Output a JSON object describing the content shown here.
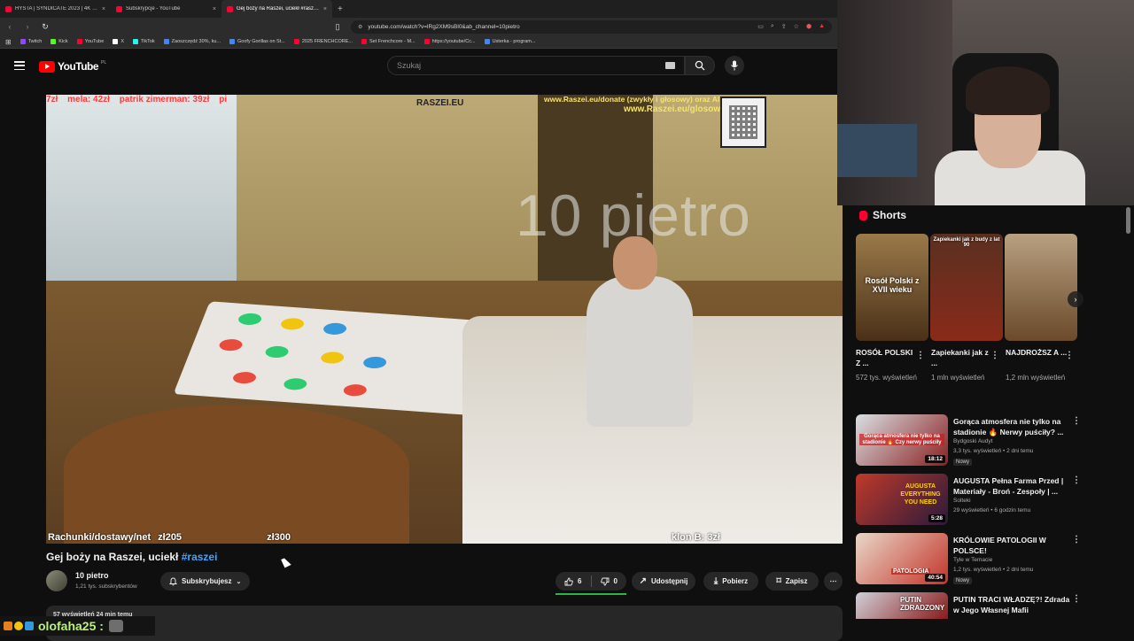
{
  "browser": {
    "tabs": [
      {
        "title": "HYSTA | SYNDICATE 2023 | 4K - YouTube",
        "active": false
      },
      {
        "title": "Subskrypcje - YouTube",
        "active": false
      },
      {
        "title": "Gej boży na Raszei, uciekł #raszei - YouTube",
        "active": true
      }
    ],
    "new_tab": "+",
    "url": "youtube.com/watch?v=lRg2XM9sBl0&ab_channel=10pietro",
    "bookmarks": [
      {
        "label": "Twitch",
        "color": "#9146ff"
      },
      {
        "label": "Kick",
        "color": "#53fc18"
      },
      {
        "label": "YouTube",
        "color": "#ff0033"
      },
      {
        "label": "X",
        "color": "#ffffff"
      },
      {
        "label": "TikTok",
        "color": "#25f4ee"
      },
      {
        "label": "Zaoszczędź 30%, ku...",
        "color": "#4285f4"
      },
      {
        "label": "Goofy Gorillas on St...",
        "color": "#4285f4"
      },
      {
        "label": "2025 FRENCHCORE...",
        "color": "#ff0033"
      },
      {
        "label": "Set Frenchcore - M...",
        "color": "#ff0033"
      },
      {
        "label": "https://youtube/Cc...",
        "color": "#ff0033"
      },
      {
        "label": "Usterka - program...",
        "color": "#4285f4"
      }
    ]
  },
  "yt_header": {
    "logo": "YouTube",
    "country": "PL",
    "search_placeholder": "Szukaj"
  },
  "video_overlay": {
    "top_donations": [
      "7zł",
      "mela: 42zł",
      "patrik zimerman: 39zł",
      "pi"
    ],
    "brand": "RASZEI.EU",
    "donate_url": "www.Raszei.eu/donate (zwykły i głosowy) oraz AI Lek",
    "glosowe_url": "www.Raszei.eu/glosowe",
    "watermark": "10 pietro",
    "bottom_left": "Rachunki/dostawy/net",
    "bottom_amount1": "zł205",
    "bottom_amount2": "zł300",
    "bottom_right": "klon B: 3zł"
  },
  "video": {
    "title": "Gej boży na Raszei, uciekł ",
    "hashtag": "#raszei",
    "channel_name": "10 pietro",
    "channel_subs": "1,21 tys. subskrybentów",
    "subscribe_label": "Subskrybujesz",
    "likes": "6",
    "dislikes": "0",
    "like_ratio": 1.0,
    "share_label": "Udostępnij",
    "download_label": "Pobierz",
    "save_label": "Zapisz",
    "description_partial": "57 wyświetleń  24 min temu"
  },
  "chat": {
    "username": "olofaha25 :"
  },
  "sidebar": {
    "shorts_title": "Shorts",
    "shorts": [
      {
        "title": "ROSÓŁ POLSKI Z ...",
        "views": "572 tys. wyświetleń",
        "caption": "Rosół Polski z XVII wieku",
        "bg": "#6a4a2a"
      },
      {
        "title": "Zapiekanki jak z ...",
        "views": "1 mln wyświetleń",
        "caption": "Zapiekanki jak z budy z lat 90",
        "bg": "#7a2e1e"
      },
      {
        "title": "NAJDROŻSZ A ...",
        "views": "1,2 mln wyświetleń",
        "caption": "",
        "bg": "#8a6a4a"
      }
    ],
    "videos": [
      {
        "title": "Gorąca atmosfera nie tylko na stadionie 🔥 Nerwy puściły? ...",
        "channel": "Bydgoski Audyt",
        "meta": "3,3 tys. wyświetleń • 2 dni temu",
        "badge": "Nowy",
        "duration": "18:12",
        "bg": "#c0392b",
        "caption": "Gorąca atmosfera nie tylko na stadionie 🔥 Czy nerwy puściły"
      },
      {
        "title": "AUGUSTA Pełna Farma Przed | Materiały - Broń - Zespoły | ...",
        "channel": "Solteki",
        "meta": "29 wyświetleń • 6 godzin temu",
        "badge": "",
        "duration": "5:28",
        "bg": "#6b1f1f",
        "caption": "AUGUSTA EVERYTHING YOU NEED"
      },
      {
        "title": "KRÓLOWIE PATOLOGII W POLSCE!",
        "channel": "Tyle w Temacie",
        "meta": "1,2 tys. wyświetleń • 2 dni temu",
        "badge": "Nowy",
        "duration": "40:54",
        "bg": "#c4332a",
        "caption": "PATOLOGIA"
      },
      {
        "title": "PUTIN TRACI WŁADZĘ?! Zdrada w Jego Własnej Mafii",
        "channel": "",
        "meta": "",
        "badge": "",
        "duration": "",
        "bg": "#2a2a3a",
        "caption": "PUTIN ZDRADZONY"
      }
    ]
  }
}
